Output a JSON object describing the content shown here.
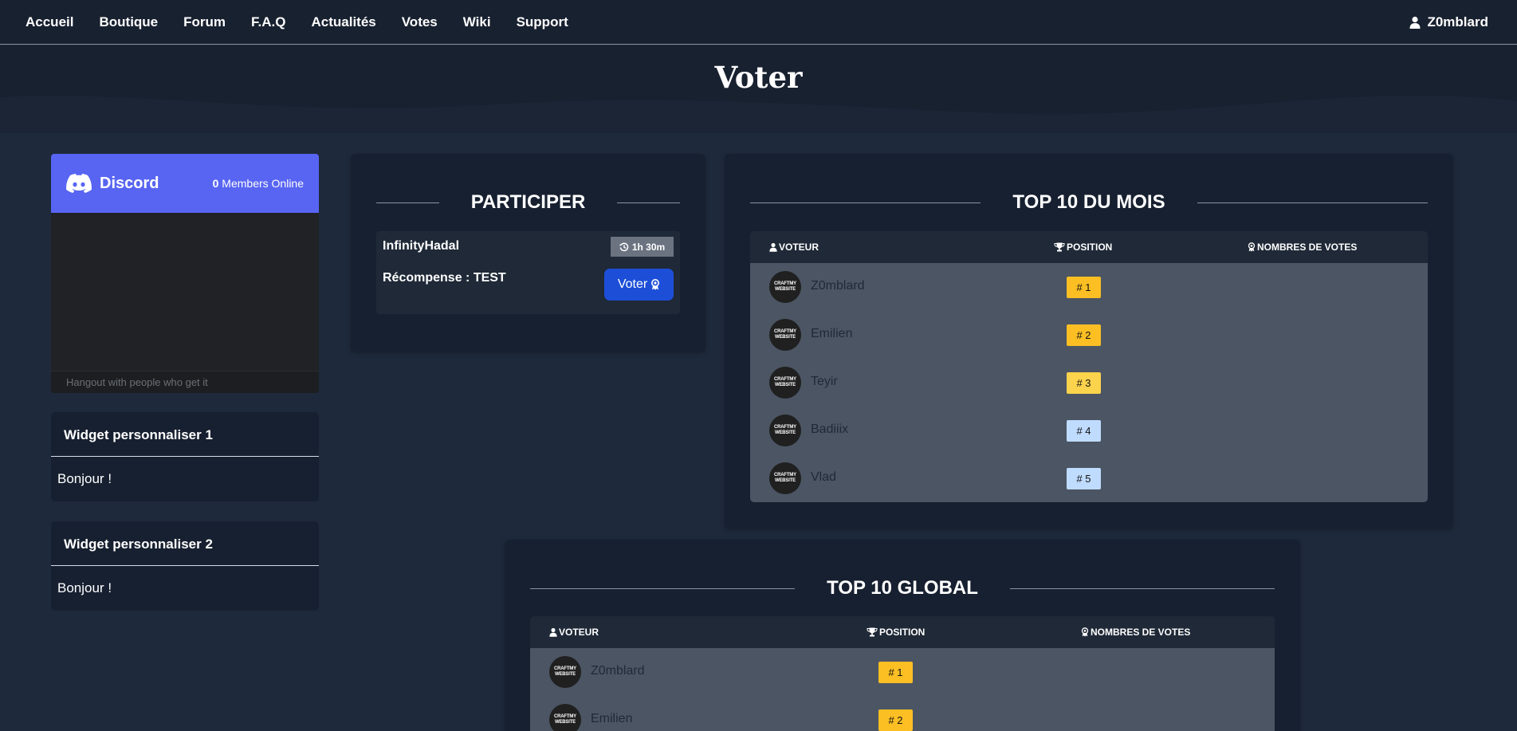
{
  "nav": {
    "links": [
      "Accueil",
      "Boutique",
      "Forum",
      "F.A.Q",
      "Actualités",
      "Votes",
      "Wiki",
      "Support"
    ],
    "user": "Z0mblard",
    "user_icon": "user-icon"
  },
  "page": {
    "title": "Voter"
  },
  "discord": {
    "brand": "Discord",
    "members_count": "0",
    "members_label": "Members Online",
    "footer": "Hangout with people who get it"
  },
  "widgets": [
    {
      "title": "Widget personnaliser 1",
      "content": "Bonjour !"
    },
    {
      "title": "Widget personnaliser 2",
      "content": "Bonjour !"
    }
  ],
  "participer": {
    "heading": "PARTICIPER",
    "site": "InfinityHadal",
    "timer": "1h 30m",
    "reward": "Récompense : TEST",
    "button": "Voter"
  },
  "top_month": {
    "heading": "TOP 10 DU MOIS",
    "columns": [
      "VOTEUR",
      "POSITION",
      "NOMBRES DE VOTES"
    ],
    "rows": [
      {
        "name": "Z0mblard",
        "position": "# 1",
        "votes": ""
      },
      {
        "name": "Emilien",
        "position": "# 2",
        "votes": ""
      },
      {
        "name": "Teyir",
        "position": "# 3",
        "votes": ""
      },
      {
        "name": "Badiiix",
        "position": "# 4",
        "votes": ""
      },
      {
        "name": "Vlad",
        "position": "# 5",
        "votes": ""
      }
    ]
  },
  "top_global": {
    "heading": "TOP 10 GLOBAL",
    "columns": [
      "VOTEUR",
      "POSITION",
      "NOMBRES DE VOTES"
    ],
    "rows": [
      {
        "name": "Z0mblard",
        "position": "# 1",
        "votes": ""
      },
      {
        "name": "Emilien",
        "position": "# 2",
        "votes": ""
      }
    ]
  },
  "avatar_text": [
    "CRAFTMY",
    "WEBSITE"
  ],
  "colors": {
    "accent": "#1d4ed8",
    "discord": "#5865f2",
    "badge_gold": "#fbbf24",
    "badge_light_gold": "#fcd34d",
    "badge_blue": "#bfdbfe"
  }
}
